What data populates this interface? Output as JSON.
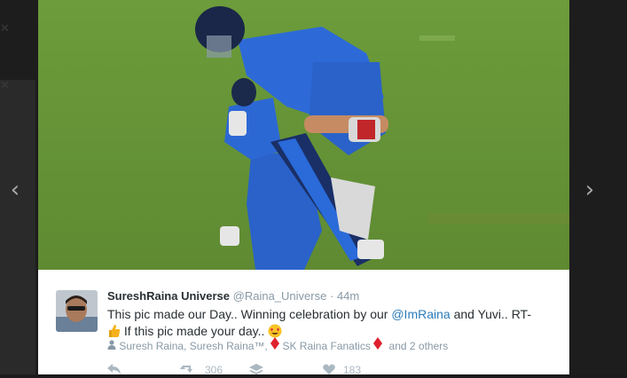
{
  "tweet": {
    "display_name": "SureshRaina Universe",
    "handle": "@Raina_Universe",
    "separator": "·",
    "time": "44m",
    "text_before": "This pic made our Day.. Winning celebration by our ",
    "mention": "@ImRaina",
    "text_middle": " and Yuvi.. RT-",
    "text_line2": " If this pic made your day..",
    "mentions_summary": "Suresh Raina, Suresh Raina™,",
    "mentions_group": "SK Raina Fanatics",
    "mentions_others": "and 2 others",
    "retweet_count": "306",
    "like_count": "183"
  },
  "icons": {
    "prev": "chevron-left-icon",
    "next": "chevron-right-icon",
    "close": "close-icon",
    "thumbs": "thumbs-up-icon",
    "heart_eyes": "heart-eyes-emoji",
    "user": "user-icon",
    "diamond": "red-diamond-icon",
    "reply": "reply-icon",
    "retweet": "retweet-icon",
    "stack": "stack-icon",
    "heart": "heart-icon"
  },
  "colors": {
    "link": "#2b7bb9",
    "jersey": "#2a62c9",
    "grass": "#6e9a3a"
  }
}
